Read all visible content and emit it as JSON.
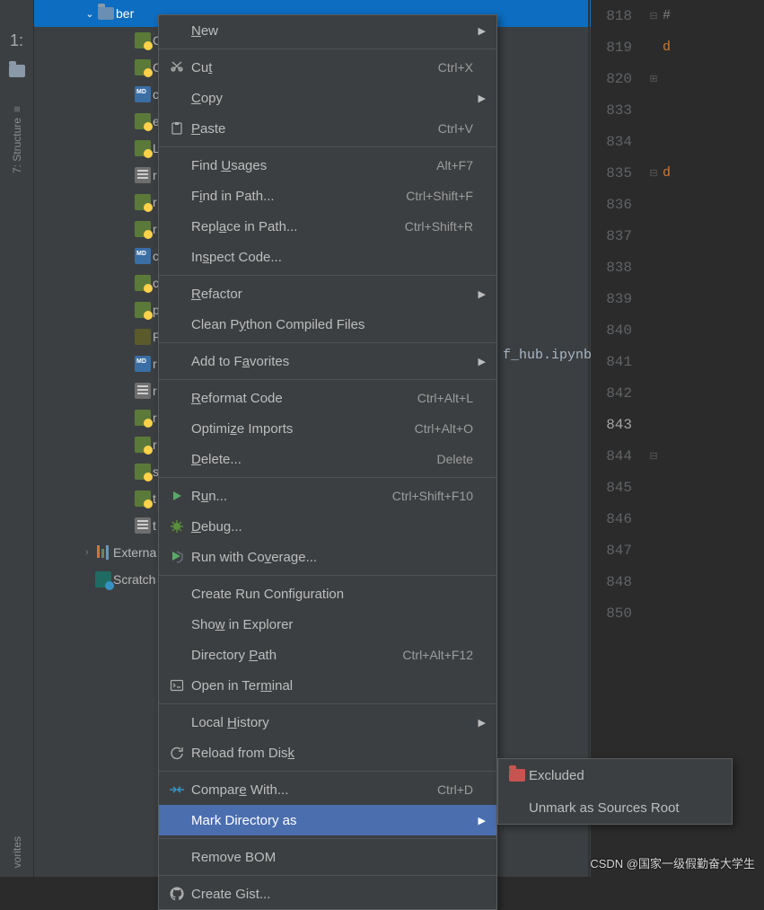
{
  "sidebar_left": {
    "project_num": "1:",
    "structure_label": "7: Structure",
    "favorites_label": "vorites"
  },
  "project_tree": {
    "folder": "ber",
    "files": [
      "C",
      "C",
      "c",
      "e",
      "L",
      "r",
      "r",
      "r",
      "c",
      "c",
      "p",
      "R",
      "r",
      "r",
      "r",
      "r",
      "s",
      "t",
      "t"
    ],
    "externals_label": "Externa",
    "scratches_label": "Scratch"
  },
  "editor": {
    "visible_snippet": "f_hub.ipynb",
    "lines": [
      {
        "n": "818",
        "mark": "⊟",
        "code": "#",
        "cls": "cm"
      },
      {
        "n": "819",
        "mark": "",
        "code": "d",
        "cls": "kw"
      },
      {
        "n": "820",
        "mark": "⊞",
        "code": "",
        "cls": ""
      },
      {
        "n": "833",
        "mark": "",
        "code": "",
        "cls": ""
      },
      {
        "n": "834",
        "mark": "",
        "code": "",
        "cls": ""
      },
      {
        "n": "835",
        "mark": "⊟",
        "code": "d",
        "cls": "kw"
      },
      {
        "n": "836",
        "mark": "",
        "code": "",
        "cls": ""
      },
      {
        "n": "837",
        "mark": "",
        "code": "",
        "cls": ""
      },
      {
        "n": "838",
        "mark": "",
        "code": "",
        "cls": ""
      },
      {
        "n": "839",
        "mark": "",
        "code": "",
        "cls": ""
      },
      {
        "n": "840",
        "mark": "",
        "code": "",
        "cls": ""
      },
      {
        "n": "841",
        "mark": "",
        "code": "",
        "cls": ""
      },
      {
        "n": "842",
        "mark": "",
        "code": "",
        "cls": ""
      },
      {
        "n": "843",
        "mark": "",
        "code": "",
        "cls": "",
        "current": true
      },
      {
        "n": "844",
        "mark": "⊟",
        "code": "",
        "cls": ""
      },
      {
        "n": "845",
        "mark": "",
        "code": "",
        "cls": ""
      },
      {
        "n": "846",
        "mark": "",
        "code": "",
        "cls": ""
      },
      {
        "n": "847",
        "mark": "",
        "code": "",
        "cls": ""
      },
      {
        "n": "848",
        "mark": "",
        "code": "",
        "cls": ""
      },
      {
        "n": "850",
        "mark": "",
        "code": "",
        "cls": ""
      }
    ]
  },
  "context_menu": [
    {
      "type": "item",
      "label": "<u>N</u>ew",
      "shortcut": "",
      "arrow": true
    },
    {
      "type": "sep"
    },
    {
      "type": "item",
      "icon": "cut",
      "label": "Cu<u>t</u>",
      "shortcut": "Ctrl+X"
    },
    {
      "type": "item",
      "label": "<u>C</u>opy",
      "shortcut": "",
      "arrow": true
    },
    {
      "type": "item",
      "icon": "paste",
      "label": "<u>P</u>aste",
      "shortcut": "Ctrl+V"
    },
    {
      "type": "sep"
    },
    {
      "type": "item",
      "label": "Find <u>U</u>sages",
      "shortcut": "Alt+F7"
    },
    {
      "type": "item",
      "label": "F<u>i</u>nd in Path...",
      "shortcut": "Ctrl+Shift+F"
    },
    {
      "type": "item",
      "label": "Repl<u>a</u>ce in Path...",
      "shortcut": "Ctrl+Shift+R"
    },
    {
      "type": "item",
      "label": "In<u>s</u>pect Code...",
      "shortcut": ""
    },
    {
      "type": "sep"
    },
    {
      "type": "item",
      "label": "<u>R</u>efactor",
      "shortcut": "",
      "arrow": true
    },
    {
      "type": "item",
      "label": "Clean P<u>y</u>thon Compiled Files",
      "shortcut": ""
    },
    {
      "type": "sep"
    },
    {
      "type": "item",
      "label": "Add to F<u>a</u>vorites",
      "shortcut": "",
      "arrow": true
    },
    {
      "type": "sep"
    },
    {
      "type": "item",
      "label": "<u>R</u>eformat Code",
      "shortcut": "Ctrl+Alt+L"
    },
    {
      "type": "item",
      "label": "Optimi<u>z</u>e Imports",
      "shortcut": "Ctrl+Alt+O"
    },
    {
      "type": "item",
      "label": "<u>D</u>elete...",
      "shortcut": "Delete"
    },
    {
      "type": "sep"
    },
    {
      "type": "item",
      "icon": "run",
      "label": "R<u>u</u>n...",
      "shortcut": "Ctrl+Shift+F10"
    },
    {
      "type": "item",
      "icon": "debug",
      "label": "<u>D</u>ebug...",
      "shortcut": ""
    },
    {
      "type": "item",
      "icon": "coverage",
      "label": "Run with Co<u>v</u>erage...",
      "shortcut": ""
    },
    {
      "type": "sep"
    },
    {
      "type": "item",
      "label": "Create Run Configuration",
      "shortcut": ""
    },
    {
      "type": "item",
      "label": "Sho<u>w</u> in Explorer",
      "shortcut": ""
    },
    {
      "type": "item",
      "label": "Directory <u>P</u>ath",
      "shortcut": "Ctrl+Alt+F12"
    },
    {
      "type": "item",
      "icon": "terminal",
      "label": "Open in Ter<u>m</u>inal",
      "shortcut": ""
    },
    {
      "type": "sep"
    },
    {
      "type": "item",
      "label": "Local <u>H</u>istory",
      "shortcut": "",
      "arrow": true
    },
    {
      "type": "item",
      "icon": "reload",
      "label": "Reload from Dis<u>k</u>",
      "shortcut": ""
    },
    {
      "type": "sep"
    },
    {
      "type": "item",
      "icon": "compare",
      "label": "Compar<u>e</u> With...",
      "shortcut": "Ctrl+D"
    },
    {
      "type": "item",
      "highlight": true,
      "label": "Mark Directory as",
      "shortcut": "",
      "arrow": true
    },
    {
      "type": "sep"
    },
    {
      "type": "item",
      "label": "Remove BOM",
      "shortcut": ""
    },
    {
      "type": "sep"
    },
    {
      "type": "item",
      "icon": "github",
      "label": "Create Gist...",
      "shortcut": ""
    }
  ],
  "sub_menu": [
    {
      "icon": "excluded",
      "label": "Excluded"
    },
    {
      "icon": "",
      "label": "Unmark as Sources Root"
    }
  ],
  "watermark": "CSDN @国家一级假勤奋大学生"
}
